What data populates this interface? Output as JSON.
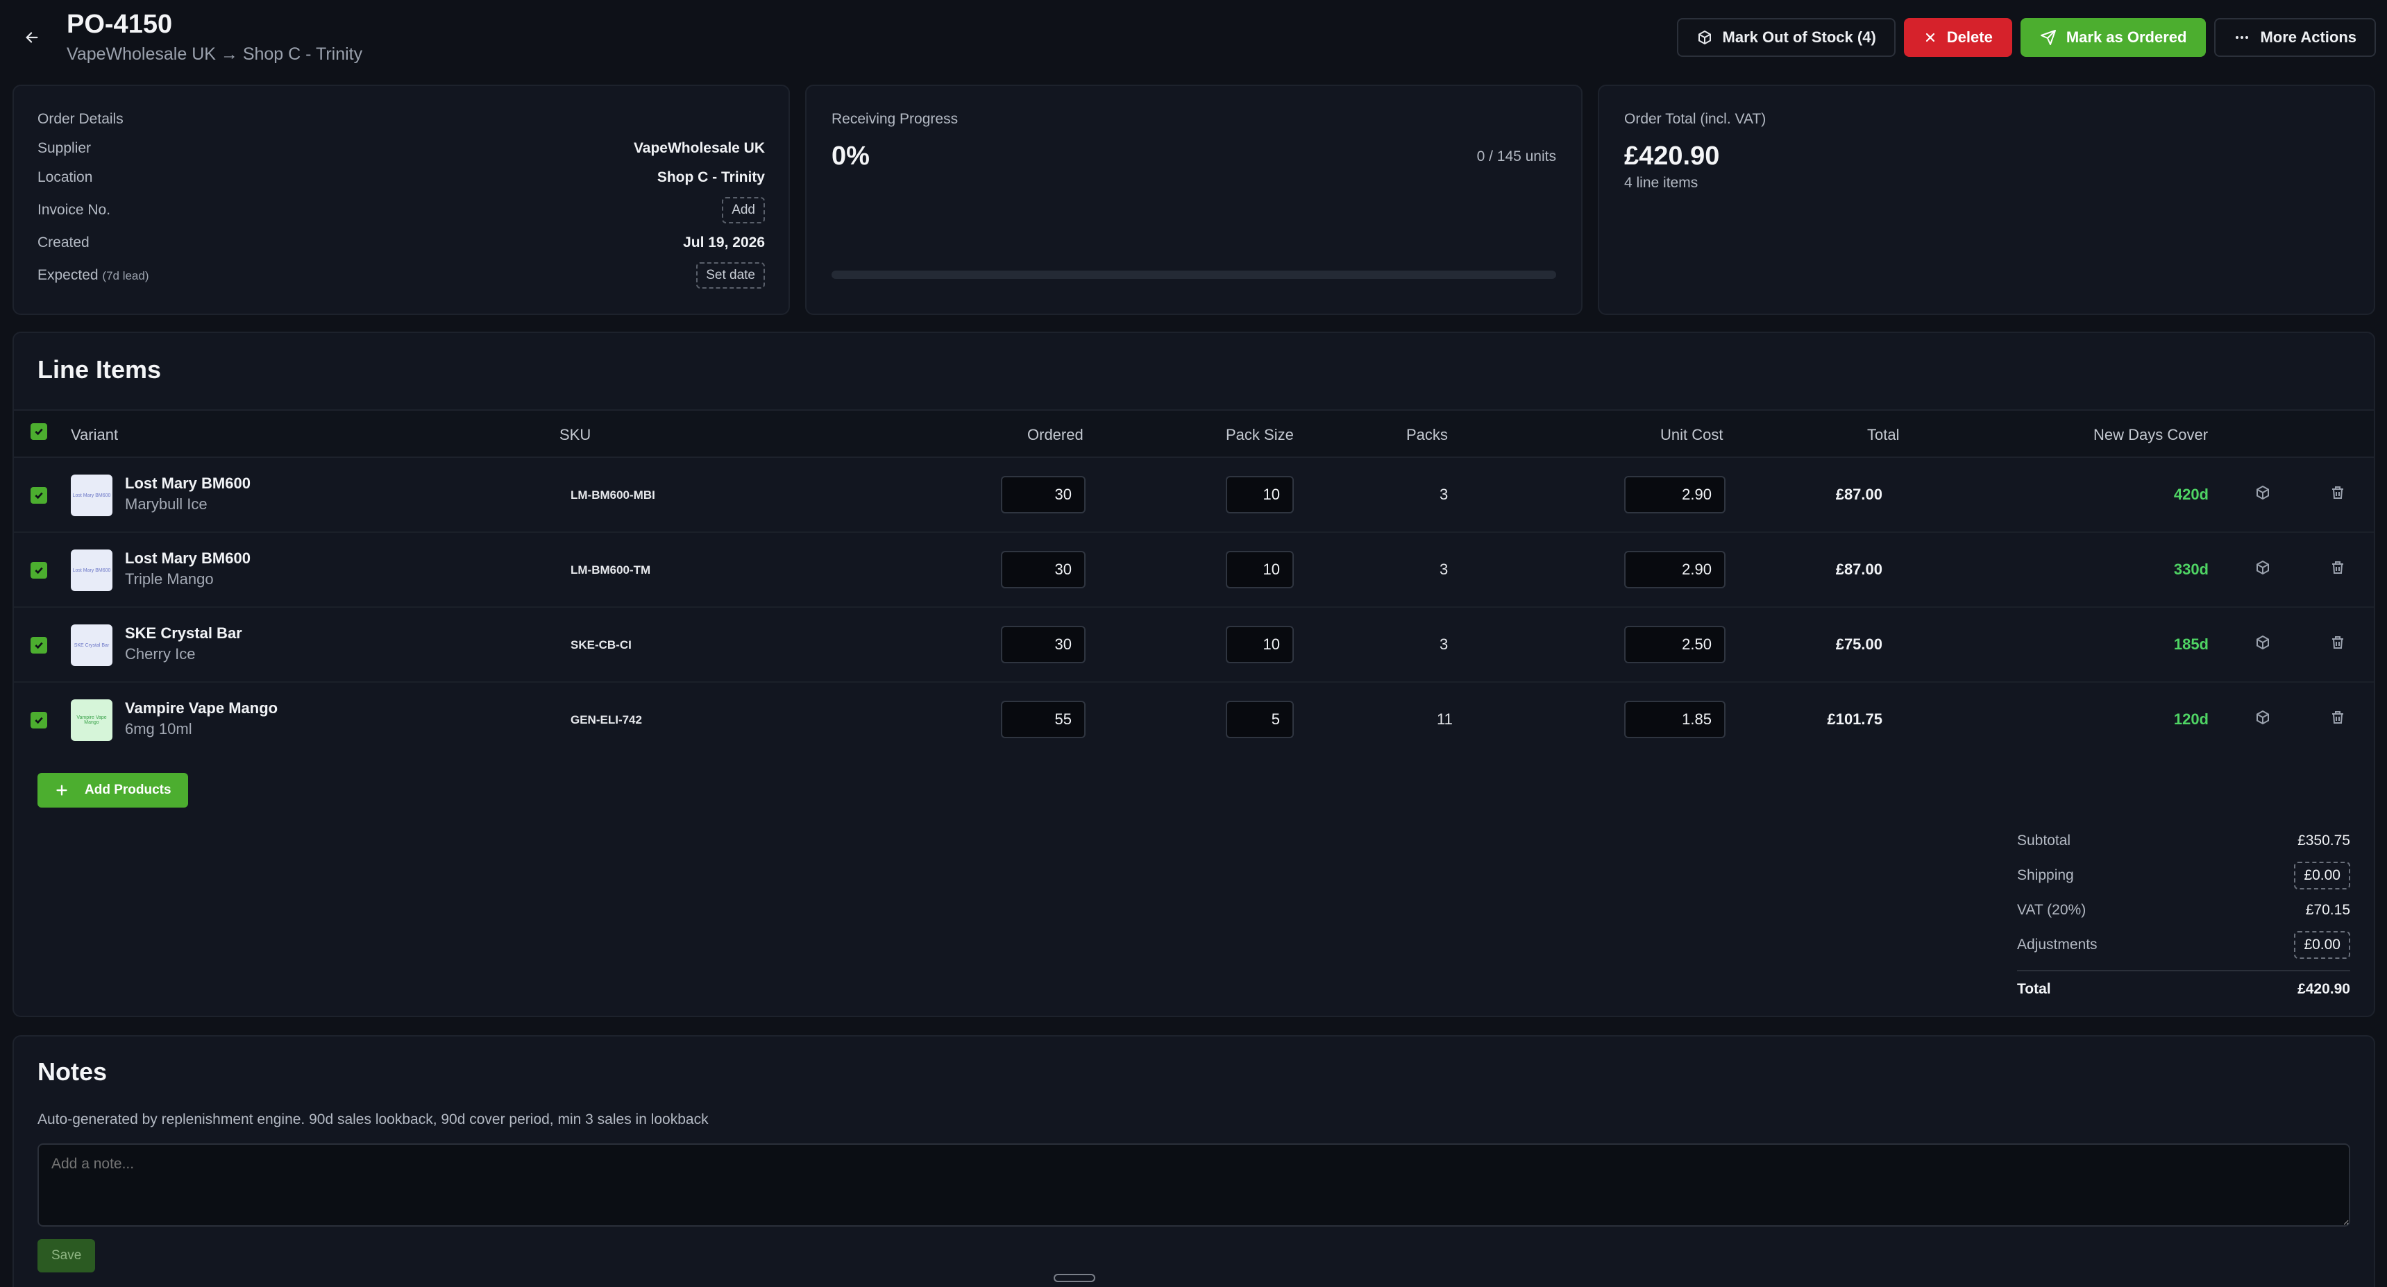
{
  "header": {
    "title": "PO-4150",
    "subtitle": "VapeWholesale UK → Shop C - Trinity",
    "actions": {
      "mark_out_of_stock": "Mark Out of Stock (4)",
      "delete": "Delete",
      "mark_as_ordered": "Mark as Ordered",
      "more_actions": "More Actions"
    }
  },
  "order_details": {
    "heading": "Order Details",
    "supplier_label": "Supplier",
    "supplier": "VapeWholesale UK",
    "location_label": "Location",
    "location": "Shop C - Trinity",
    "invoice_label": "Invoice No.",
    "invoice_action": "Add",
    "created_label": "Created",
    "created": "Jul 19, 2026",
    "expected_label": "Expected",
    "expected_note": "(7d lead)",
    "expected_action": "Set date"
  },
  "receiving": {
    "heading": "Receiving Progress",
    "percent": "0%",
    "units": "0 / 145 units",
    "progress_fraction": 0
  },
  "order_total": {
    "heading": "Order Total (incl. VAT)",
    "value": "£420.90",
    "line_items": "4 line items"
  },
  "line_items": {
    "title": "Line Items",
    "columns": {
      "variant": "Variant",
      "sku": "SKU",
      "ordered": "Ordered",
      "pack_size": "Pack Size",
      "packs": "Packs",
      "unit_cost": "Unit Cost",
      "total": "Total",
      "new_days_cover": "New Days Cover"
    },
    "rows": [
      {
        "name": "Lost Mary BM600",
        "variant": "Marybull Ice",
        "thumb": "Lost Mary BM600",
        "sku": "LM-BM600-MBI",
        "ordered": "30",
        "pack_size": "10",
        "packs": "3",
        "unit_cost": "2.90",
        "total": "£87.00",
        "cover": "420d"
      },
      {
        "name": "Lost Mary BM600",
        "variant": "Triple Mango",
        "thumb": "Lost Mary BM600",
        "sku": "LM-BM600-TM",
        "ordered": "30",
        "pack_size": "10",
        "packs": "3",
        "unit_cost": "2.90",
        "total": "£87.00",
        "cover": "330d"
      },
      {
        "name": "SKE Crystal Bar",
        "variant": "Cherry Ice",
        "thumb": "SKE Crystal Bar",
        "sku": "SKE-CB-CI",
        "ordered": "30",
        "pack_size": "10",
        "packs": "3",
        "unit_cost": "2.50",
        "total": "£75.00",
        "cover": "185d"
      },
      {
        "name": "Vampire Vape Mango",
        "variant": "6mg 10ml",
        "thumb": "Vampire Vape Mango",
        "sku": "GEN-ELI-742",
        "ordered": "55",
        "pack_size": "5",
        "packs": "11",
        "unit_cost": "1.85",
        "total": "£101.75",
        "cover": "120d"
      }
    ],
    "add_products": "Add Products"
  },
  "summary": {
    "subtotal_label": "Subtotal",
    "subtotal": "£350.75",
    "shipping_label": "Shipping",
    "shipping": "£0.00",
    "vat_label": "VAT (20%)",
    "vat": "£70.15",
    "adjustments_label": "Adjustments",
    "adjustments": "£0.00",
    "total_label": "Total",
    "total": "£420.90"
  },
  "notes": {
    "title": "Notes",
    "text": "Auto-generated by replenishment engine. 90d sales lookback, 90d cover period, min 3 sales in lookback",
    "placeholder": "Add a note...",
    "save": "Save"
  },
  "colors": {
    "accent_green": "#4cae2f",
    "danger_red": "#d6222b",
    "cover_green": "#4fd464",
    "background": "#0e1118"
  }
}
